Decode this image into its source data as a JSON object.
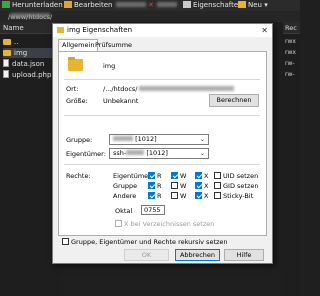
{
  "toolbar": {
    "download_label": "Herunterladen",
    "edit_label": "Bearbeiten",
    "properties_label": "Eigenschaften",
    "new_label": "Neu"
  },
  "path_bar": {
    "path": "/www/htdocs/"
  },
  "file_list": {
    "header": "Name",
    "items": [
      {
        "name": "..",
        "type": "folder"
      },
      {
        "name": "img",
        "type": "folder"
      },
      {
        "name": "data.json",
        "type": "file"
      },
      {
        "name": "upload.php",
        "type": "file"
      }
    ]
  },
  "right_list": {
    "header": "Rec",
    "items": [
      "rwx",
      "rwx",
      "rw-",
      "rw-"
    ]
  },
  "dialog": {
    "title": "img Eigenschaften",
    "close": "✕",
    "tabs": [
      "Allgemein",
      "Prüfsumme"
    ],
    "name": "img",
    "location_label": "Ort:",
    "location_value": "/.../htdocs/",
    "size_label": "Größe:",
    "size_value": "Unbekannt",
    "calculate_button": "Berechnen",
    "group_label": "Gruppe:",
    "group_value": "[1012]",
    "owner_label": "Eigentümer:",
    "owner_value": "ssh-",
    "owner_id": "[1012]",
    "rights_label": "Rechte:",
    "rows": [
      "Eigentümer",
      "Gruppe",
      "Andere"
    ],
    "cols": [
      "R",
      "W",
      "X"
    ],
    "perm": [
      [
        true,
        true,
        true
      ],
      [
        true,
        false,
        true
      ],
      [
        true,
        false,
        true
      ]
    ],
    "special": [
      "UID setzen",
      "GID setzen",
      "Sticky-Bit"
    ],
    "octal_label": "Oktal",
    "octal_value": "0755",
    "x_dirs_label": "X bei Verzeichnissen setzen",
    "recursive_label": "Gruppe, Eigentümer und Rechte rekursiv setzen",
    "ok_button": "OK",
    "cancel_button": "Abbrechen",
    "help_button": "Hilfe"
  },
  "colors": {
    "accent": "#0078d7",
    "folder": "#e8b530"
  }
}
